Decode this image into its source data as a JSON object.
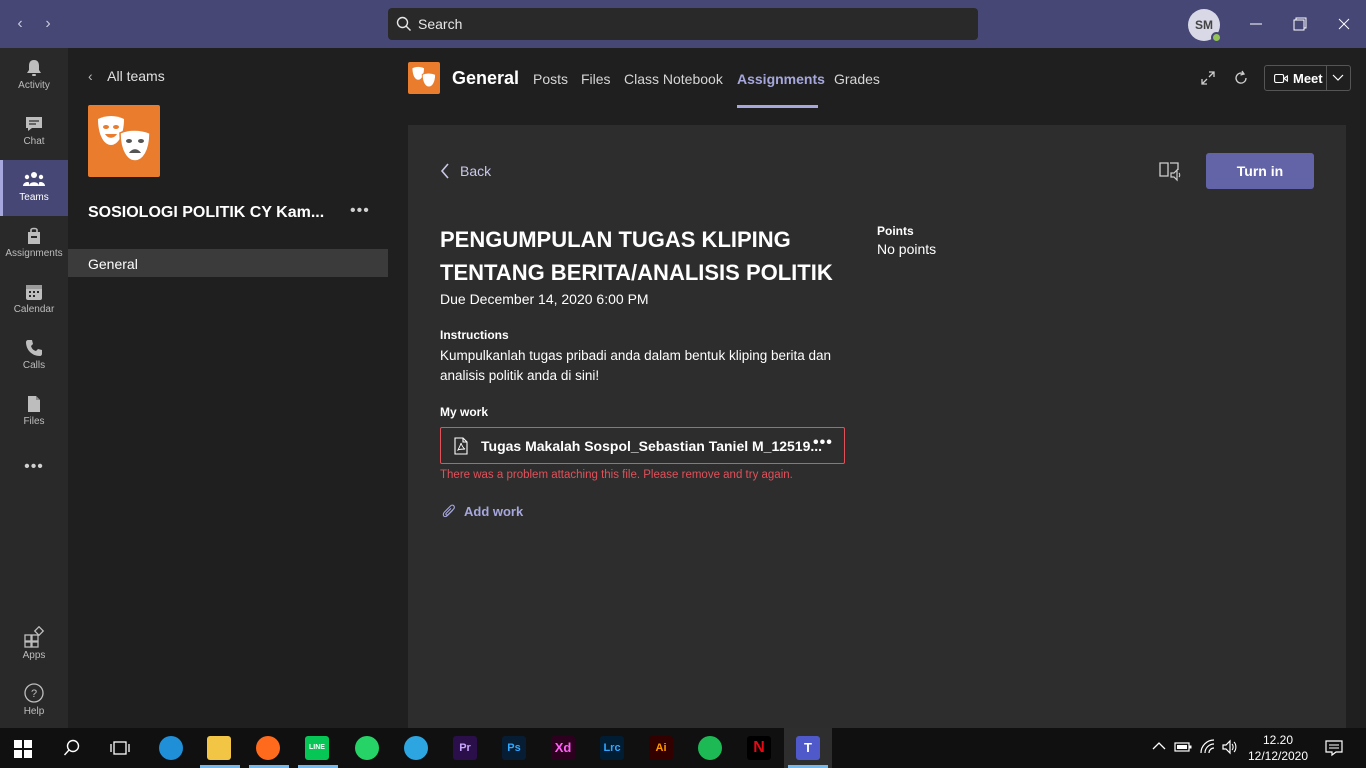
{
  "titlebar": {
    "search_placeholder": "Search",
    "avatar_initials": "SM",
    "presence_color": "#92c353"
  },
  "rail": {
    "items": [
      {
        "label": "Activity",
        "icon": "bell-icon"
      },
      {
        "label": "Chat",
        "icon": "chat-icon"
      },
      {
        "label": "Teams",
        "icon": "teams-icon",
        "active": true
      },
      {
        "label": "Assignments",
        "icon": "assignments-icon"
      },
      {
        "label": "Calendar",
        "icon": "calendar-icon"
      },
      {
        "label": "Calls",
        "icon": "phone-icon"
      },
      {
        "label": "Files",
        "icon": "file-icon"
      }
    ],
    "more": "•••",
    "apps_label": "Apps",
    "help_label": "Help"
  },
  "teams_panel": {
    "all_teams": "All teams",
    "team_name": "SOSIOLOGI POLITIK CY Kam...",
    "team_more": "•••",
    "channel": "General"
  },
  "header": {
    "channel_title": "General",
    "tabs": [
      "Posts",
      "Files",
      "Class Notebook",
      "Assignments",
      "Grades"
    ],
    "active_tab": "Assignments",
    "meet_label": "Meet"
  },
  "assignment": {
    "back_label": "Back",
    "turn_in_label": "Turn in",
    "title": "PENGUMPULAN TUGAS KLIPING TENTANG BERITA/ANALISIS POLITIK",
    "due": "Due December 14, 2020 6:00 PM",
    "instructions_label": "Instructions",
    "instructions": "Kumpulkanlah tugas pribadi anda dalam bentuk kliping berita dan analisis politik anda di sini!",
    "my_work_label": "My work",
    "file_name": "Tugas Makalah Sospol_Sebastian Taniel M_12519...",
    "file_more": "•••",
    "error": "There was a problem attaching this file. Please remove and try again.",
    "add_work_label": "Add work",
    "points_label": "Points",
    "points_value": "No points"
  },
  "taskbar": {
    "apps": [
      {
        "name": "start-icon"
      },
      {
        "name": "search-icon"
      },
      {
        "name": "task-view-icon"
      },
      {
        "name": "edge-icon"
      },
      {
        "name": "file-explorer-icon"
      },
      {
        "name": "firefox-icon"
      },
      {
        "name": "line-icon",
        "text": "LINE"
      },
      {
        "name": "whatsapp-icon"
      },
      {
        "name": "telegram-icon"
      },
      {
        "name": "premiere-icon",
        "text": "Pr"
      },
      {
        "name": "photoshop-icon",
        "text": "Ps"
      },
      {
        "name": "xd-icon",
        "text": "Xd"
      },
      {
        "name": "lightroom-icon",
        "text": "Lrc"
      },
      {
        "name": "illustrator-icon",
        "text": "Ai"
      },
      {
        "name": "spotify-icon"
      },
      {
        "name": "netflix-icon",
        "text": "N"
      },
      {
        "name": "teams-icon",
        "text": "T"
      }
    ],
    "time": "12.20",
    "date": "12/12/2020"
  },
  "colors": {
    "brand": "#464775",
    "accent": "#6264a7",
    "accent_light": "#a6a7dc",
    "error": "#e0515a",
    "team_orange": "#e97c2d"
  }
}
